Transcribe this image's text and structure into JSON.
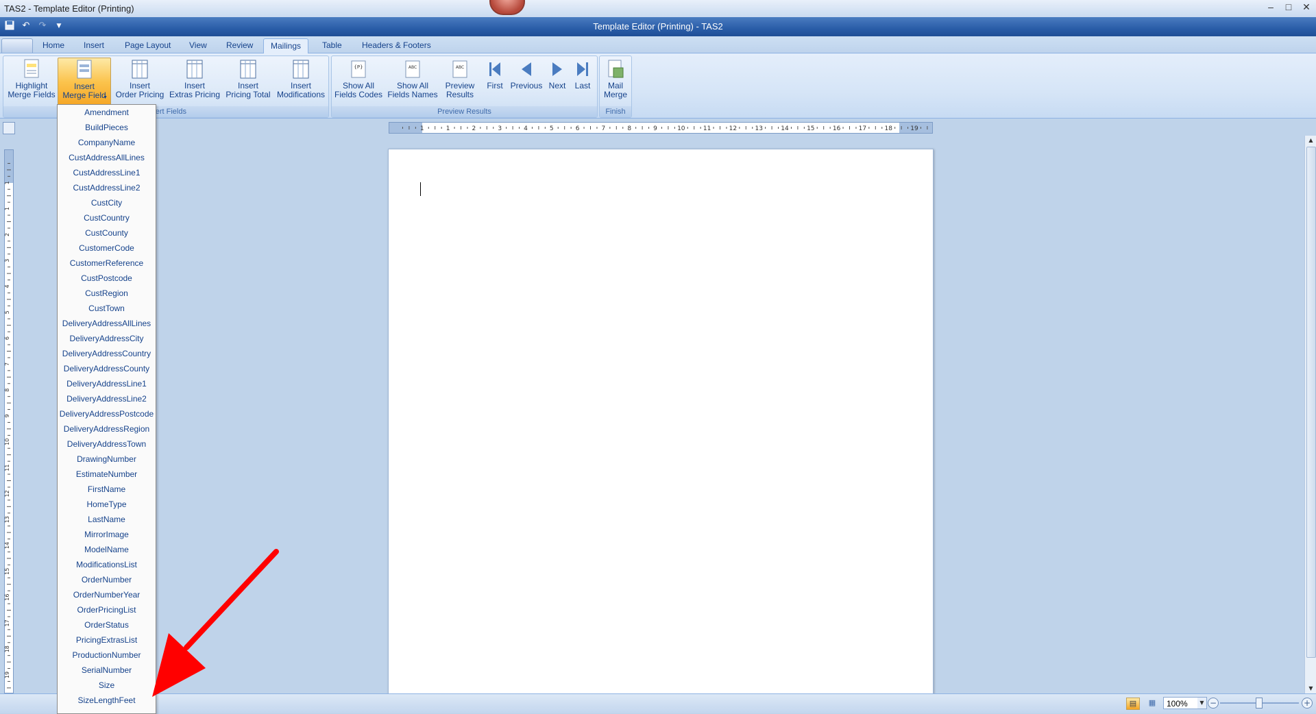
{
  "window": {
    "outer_title": "TAS2 - Template Editor (Printing)",
    "app_title": "Template Editor (Printing) - TAS2",
    "controls": [
      "–",
      "□",
      "✕"
    ]
  },
  "tabs": [
    {
      "label": "Home"
    },
    {
      "label": "Insert"
    },
    {
      "label": "Page Layout"
    },
    {
      "label": "View"
    },
    {
      "label": "Review"
    },
    {
      "label": "Mailings",
      "active": true
    },
    {
      "label": "Table"
    },
    {
      "label": "Headers & Footers"
    }
  ],
  "ribbon": {
    "insert_fields_group": {
      "label": "Insert Fields",
      "buttons": [
        {
          "label": "Highlight\nMerge Fields",
          "icon": "highlight-fields-icon"
        },
        {
          "label": "Insert\nMerge Field",
          "icon": "merge-field-icon",
          "pressed": true
        },
        {
          "label": "Insert\nOrder Pricing",
          "icon": "table-icon"
        },
        {
          "label": "Insert\nExtras Pricing",
          "icon": "table-icon"
        },
        {
          "label": "Insert\nPricing Total",
          "icon": "table-icon"
        },
        {
          "label": "Insert\nModifications",
          "icon": "table-icon"
        }
      ]
    },
    "preview_group": {
      "label": "Preview Results",
      "buttons": [
        {
          "label": "Show All\nFields Codes",
          "icon": "field-codes-icon"
        },
        {
          "label": "Show All\nFields Names",
          "icon": "field-names-icon"
        },
        {
          "label": "Preview\nResults",
          "icon": "preview-results-icon"
        },
        {
          "label": "First",
          "icon": "first-record-icon"
        },
        {
          "label": "Previous",
          "icon": "previous-record-icon"
        },
        {
          "label": "Next",
          "icon": "next-record-icon"
        },
        {
          "label": "Last",
          "icon": "last-record-icon"
        }
      ]
    },
    "finish_group": {
      "label": "Finish",
      "buttons": [
        {
          "label": "Mail\nMerge",
          "icon": "mail-merge-icon"
        }
      ]
    }
  },
  "merge_fields": [
    "Amendment",
    "BuildPieces",
    "CompanyName",
    "CustAddressAllLines",
    "CustAddressLine1",
    "CustAddressLine2",
    "CustCity",
    "CustCountry",
    "CustCounty",
    "CustomerCode",
    "CustomerReference",
    "CustPostcode",
    "CustRegion",
    "CustTown",
    "DeliveryAddressAllLines",
    "DeliveryAddressCity",
    "DeliveryAddressCountry",
    "DeliveryAddressCounty",
    "DeliveryAddressLine1",
    "DeliveryAddressLine2",
    "DeliveryAddressPostcode",
    "DeliveryAddressRegion",
    "DeliveryAddressTown",
    "DrawingNumber",
    "EstimateNumber",
    "FirstName",
    "HomeType",
    "LastName",
    "MirrorImage",
    "ModelName",
    "ModificationsList",
    "OrderNumber",
    "OrderNumberYear",
    "OrderPricingList",
    "OrderStatus",
    "PricingExtrasList",
    "ProductionNumber",
    "SerialNumber",
    "Size",
    "SizeLengthFeet"
  ],
  "ruler": {
    "h_numbers": [
      "1",
      "1",
      "2",
      "3",
      "4",
      "5",
      "6",
      "7",
      "8",
      "9",
      "10",
      "11",
      "12",
      "13",
      "14",
      "15",
      "16",
      "17",
      "18",
      "19"
    ],
    "v_numbers": [
      "1",
      "1",
      "2",
      "3",
      "4",
      "5",
      "6",
      "7",
      "8",
      "9",
      "10",
      "11",
      "12",
      "13",
      "14",
      "15",
      "16",
      "17",
      "18",
      "19"
    ]
  },
  "statusbar": {
    "zoom": "100%"
  },
  "colors": {
    "annotation_arrow": "#ff0000",
    "pressed_button": "#fbc34c"
  }
}
